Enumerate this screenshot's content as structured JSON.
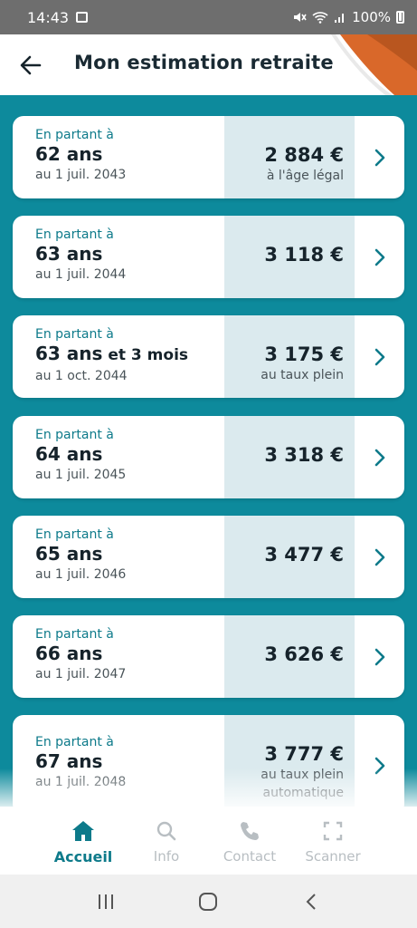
{
  "status_bar": {
    "time": "14:43",
    "battery": "100%"
  },
  "header": {
    "title": "Mon estimation retraite"
  },
  "estimates": [
    {
      "lead": "En partant à",
      "age": "62 ans",
      "age_extra": "",
      "date": "au 1 juil. 2043",
      "amount": "2 884 €",
      "note": "à l'âge légal"
    },
    {
      "lead": "En partant à",
      "age": "63 ans",
      "age_extra": "",
      "date": "au 1 juil. 2044",
      "amount": "3 118 €",
      "note": ""
    },
    {
      "lead": "En partant à",
      "age": "63 ans",
      "age_extra": " et 3 mois",
      "date": "au 1 oct. 2044",
      "amount": "3 175 €",
      "note": "au taux plein"
    },
    {
      "lead": "En partant à",
      "age": "64 ans",
      "age_extra": "",
      "date": "au 1 juil. 2045",
      "amount": "3 318 €",
      "note": ""
    },
    {
      "lead": "En partant à",
      "age": "65 ans",
      "age_extra": "",
      "date": "au 1 juil. 2046",
      "amount": "3 477 €",
      "note": ""
    },
    {
      "lead": "En partant à",
      "age": "66 ans",
      "age_extra": "",
      "date": "au 1 juil. 2047",
      "amount": "3 626 €",
      "note": ""
    },
    {
      "lead": "En partant à",
      "age": "67 ans",
      "age_extra": "",
      "date": "au 1 juil. 2048",
      "amount": "3 777 €",
      "note": "au taux plein automatique"
    }
  ],
  "tabs": [
    {
      "label": "Accueil",
      "icon": "home-icon",
      "active": true
    },
    {
      "label": "Info",
      "icon": "search-icon",
      "active": false
    },
    {
      "label": "Contact",
      "icon": "phone-icon",
      "active": false
    },
    {
      "label": "Scanner",
      "icon": "scan-icon",
      "active": false
    }
  ],
  "colors": {
    "accent": "#0d7a8a",
    "background": "#0d8a9c",
    "amount_panel": "#dbeaee",
    "header_deco": "#d9682a"
  }
}
